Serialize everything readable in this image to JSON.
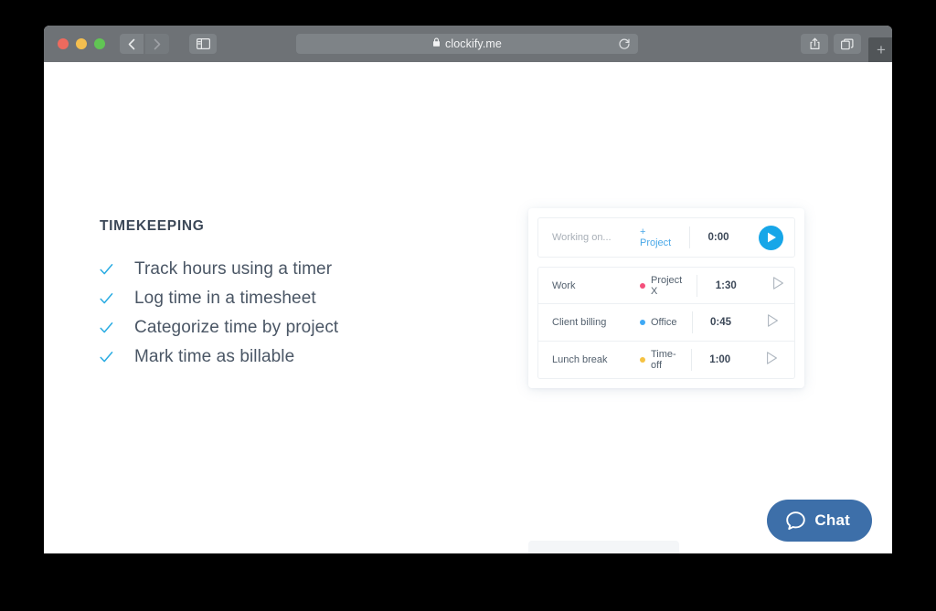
{
  "browser": {
    "url": "clockify.me",
    "lock_icon": "lock-icon",
    "reload_icon": "reload-icon",
    "back_icon": "chevron-left-icon",
    "forward_icon": "chevron-right-icon",
    "sidebar_icon": "sidebar-toggle-icon",
    "share_icon": "share-icon",
    "tabs_icon": "tab-overview-icon",
    "new_tab_label": "+",
    "traffic_lights": [
      "close",
      "minimize",
      "zoom"
    ]
  },
  "features": {
    "title": "TIMEKEEPING",
    "check_icon": "check-icon",
    "items": [
      {
        "label": "Track hours using a timer"
      },
      {
        "label": "Log time in a timesheet"
      },
      {
        "label": "Categorize time by project"
      },
      {
        "label": "Mark time as billable"
      }
    ]
  },
  "timer_widget": {
    "timer_row": {
      "description_placeholder": "Working on...",
      "project_label": "+ Project",
      "duration": "0:00",
      "action_icon": "play-filled-icon"
    },
    "entries": [
      {
        "description": "Work",
        "project": "Project X",
        "project_color": "#f4507b",
        "duration": "1:30",
        "action_icon": "play-outline-icon"
      },
      {
        "description": "Client billing",
        "project": "Office",
        "project_color": "#3fa9f5",
        "duration": "0:45",
        "action_icon": "play-outline-icon"
      },
      {
        "description": "Lunch break",
        "project": "Time-off",
        "project_color": "#f5c242",
        "duration": "1:00",
        "action_icon": "play-outline-icon"
      }
    ]
  },
  "chat": {
    "label": "Chat",
    "icon": "chat-bubble-icon",
    "color": "#3d6fa9"
  },
  "colors": {
    "accent_blue": "#29abe2",
    "play_blue": "#17a6e8",
    "heading": "#3c4858",
    "toolbar": "#6e7276"
  }
}
